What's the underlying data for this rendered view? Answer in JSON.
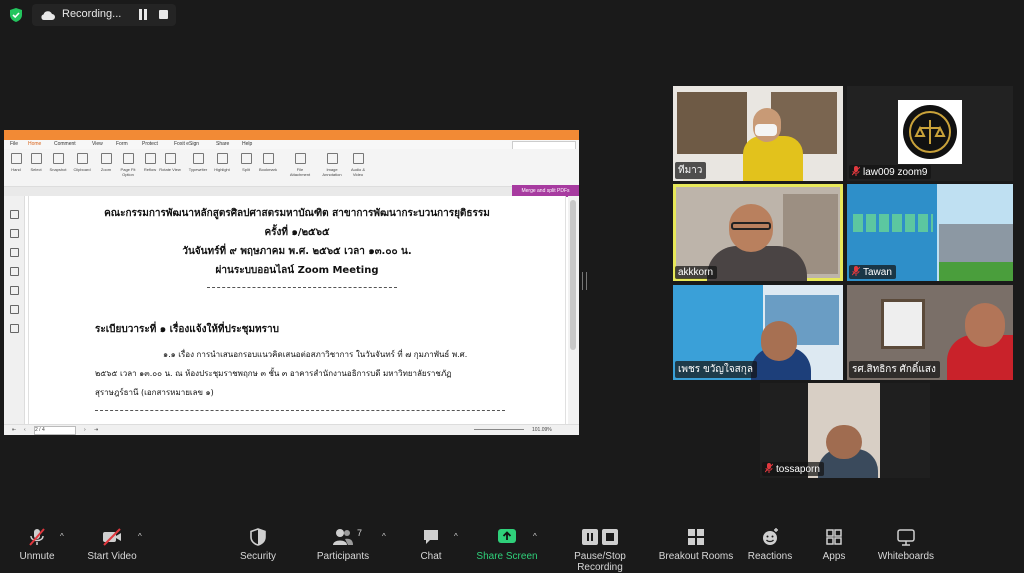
{
  "recording": {
    "label": "Recording..."
  },
  "document": {
    "title_line1": "คณะกรรมการพัฒนาหลักสูตรศิลปศาสตรมหาบัณฑิต สาขาการพัฒนากระบวนการยุติธรรม",
    "title_line2": "ครั้งที่ ๑/๒๕๖๕",
    "title_line3": "วันจันทร์ที่ ๙ พฤษภาคม พ.ศ. ๒๕๖๕ เวลา ๑๓.๐๐ น.",
    "title_line4": "ผ่านระบบออนไลน์ Zoom Meeting",
    "agenda_heading": "ระเบียบวาระที่ ๑ เรื่องแจ้งให้ที่ประชุมทราบ",
    "item_line1": "๑.๑ เรื่อง การนำเสนอกรอบแนวคิดเสนอต่อสภาวิชาการ ในวันจันทร์ ที่ ๗ กุมภาพันธ์ พ.ศ.",
    "item_line2": "๒๕๖๕ เวลา ๑๓.๐๐ น. ณ ห้องประชุมราชพฤกษ ๓ ชั้น ๓ อาคารสำนักงานอธิการบดี มหาวิทยาลัยราชภัฏ",
    "item_line3": "สุราษฎร์ธานี (เอกสารหมายเลข ๑)"
  },
  "pdf_viewer": {
    "menu": [
      "File",
      "Home",
      "Comment",
      "View",
      "Form",
      "Protect",
      "Foxit eSign",
      "Share",
      "Help"
    ],
    "ribbon": [
      "Hand",
      "Select",
      "Snapshot",
      "Clipboard",
      "Zoom",
      "Page Fit Option",
      "Reflow",
      "Rotate View",
      "Typewriter",
      "Highlight",
      "Split",
      "Bookmark",
      "File Attachment",
      "Image Annotation",
      "Audio & Video"
    ],
    "merge_button": "Merge and split PDFs",
    "page_indicator": "2 / 4",
    "zoom": "101.09%"
  },
  "participants": [
    {
      "name": "ทีมาว",
      "muted": false
    },
    {
      "name": "law009 zoom9",
      "muted": true
    },
    {
      "name": "akkkorn",
      "muted": false
    },
    {
      "name": "Tawan",
      "muted": true
    },
    {
      "name": "เพชร ขวัญใจสกุล",
      "muted": false
    },
    {
      "name": "รศ.สิทธิกร ศักดิ์แสง",
      "muted": false
    },
    {
      "name": "tossaporn",
      "muted": true
    }
  ],
  "toolbar": {
    "unmute": "Unmute",
    "start_video": "Start Video",
    "security": "Security",
    "participants": "Participants",
    "participants_count": "7",
    "chat": "Chat",
    "share_screen": "Share Screen",
    "pause_stop": "Pause/Stop Recording",
    "breakout": "Breakout Rooms",
    "reactions": "Reactions",
    "apps": "Apps",
    "whiteboards": "Whiteboards"
  },
  "colors": {
    "accent_green": "#2fd07a",
    "active_speaker": "#e7e85a",
    "muted_red": "#e0383e",
    "pdf_orange": "#f28a35"
  }
}
